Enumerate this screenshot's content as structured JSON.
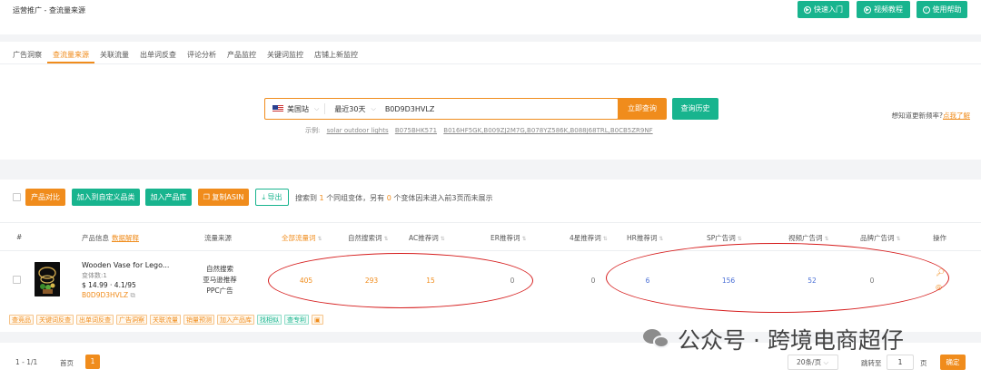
{
  "header": {
    "breadcrumb": "运营推广 - 查流量来源",
    "buttons": [
      {
        "label": "快速入门",
        "icon": "play-circle-icon"
      },
      {
        "label": "视频教程",
        "icon": "video-icon"
      },
      {
        "label": "使用帮助",
        "icon": "help-circle-icon"
      }
    ]
  },
  "tabs": [
    "广告洞察",
    "查流量来源",
    "关联流量",
    "出单词反查",
    "评论分析",
    "产品监控",
    "关键词监控",
    "店铺上新监控"
  ],
  "active_tab": "查流量来源",
  "search": {
    "site": "美国站",
    "period": "最近30天",
    "asin": "B0D9D3HVLZ",
    "query_button": "立即查询",
    "history_button": "查询历史",
    "examples_label": "示例:",
    "examples": [
      "solar outdoor lights",
      "B075BHK571",
      "B016HF5GK,B009ZJ2M7G,B078YZ586K,B088J68TRL,B0CB5ZR9NF"
    ],
    "freq_text": "想知道更新频率?",
    "freq_link": "点我了解"
  },
  "actions": {
    "compare": "产品对比",
    "add_category": "加入到自定义品类",
    "add_library": "加入产品库",
    "copy_asin": "复制ASIN",
    "export": "导出"
  },
  "result_note": {
    "prefix": "搜索到",
    "count1": "1",
    "mid": "个同组变体，另有",
    "count2": "0",
    "suffix": "个变体因未进入前3页而未展示"
  },
  "columns": {
    "index": "#",
    "product": "产品信息",
    "product_help": "数据解释",
    "source": "流量来源",
    "total": "全部流量词",
    "organic": "自然搜索词",
    "ac": "AC推荐词",
    "er": "ER推荐词",
    "four_star": "4星推荐词",
    "hr": "HR推荐词",
    "sp": "SP广告词",
    "video": "视频广告词",
    "brand": "品牌广告词",
    "ops": "操作"
  },
  "row": {
    "name": "Wooden Vase for Lego...",
    "variants": "变体数:1",
    "price": "$ 14.99",
    "rating": "4.1/95",
    "asin": "B0D9D3HVLZ",
    "sources": [
      "自然搜索",
      "亚马逊推荐",
      "PPC广告"
    ],
    "values": {
      "total": 405,
      "organic": 293,
      "ac": 15,
      "er": 0,
      "four_star": 0,
      "hr": 6,
      "sp": 156,
      "video": 52,
      "brand": 0
    }
  },
  "tags": [
    {
      "label": "查竞品",
      "style": "o"
    },
    {
      "label": "关键词反查",
      "style": "o"
    },
    {
      "label": "出单词反查",
      "style": "o"
    },
    {
      "label": "广告洞察",
      "style": "o"
    },
    {
      "label": "关联流量",
      "style": "o"
    },
    {
      "label": "销量预测",
      "style": "o"
    },
    {
      "label": "加入产品库",
      "style": "o"
    },
    {
      "label": "找相似",
      "style": "g"
    },
    {
      "label": "查专利",
      "style": "g"
    },
    {
      "label": "▣",
      "style": "o"
    }
  ],
  "pagination": {
    "info": "1 - 1/1",
    "first": "首页",
    "current": "1",
    "page_size": "20条/页",
    "jump_label": "跳转至",
    "jump_value": "1",
    "page_label": "页",
    "confirm": "确定"
  },
  "watermark": {
    "text": "公众号 · 跨境电商超仔"
  },
  "colors": {
    "accent_orange": "#f08c1c",
    "accent_green": "#18b48e",
    "link_blue": "#4a6fd6",
    "annotation_red": "#d61f1f"
  }
}
